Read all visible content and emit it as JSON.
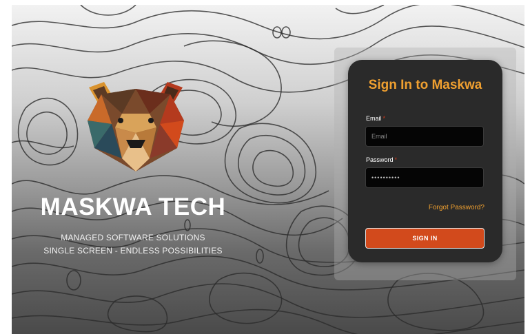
{
  "brand": {
    "title": "MASKWA TECH",
    "tagline_1": "MANAGED SOFTWARE SOLUTIONS",
    "tagline_2": "SINGLE SCREEN - ENDLESS POSSIBILITIES",
    "logo_icon": "bear-logo-icon"
  },
  "login": {
    "title": "Sign In to Maskwa",
    "email_label": "Email",
    "email_placeholder": "Email",
    "password_label": "Password",
    "password_value": "••••••••••",
    "required_mark": "*",
    "forgot_password": "Forgot Password?",
    "sign_in_label": "SIGN IN"
  },
  "colors": {
    "accent": "#f0a030",
    "button": "#d24a1c",
    "required": "#d23a1a",
    "card": "#2a2a2a"
  }
}
